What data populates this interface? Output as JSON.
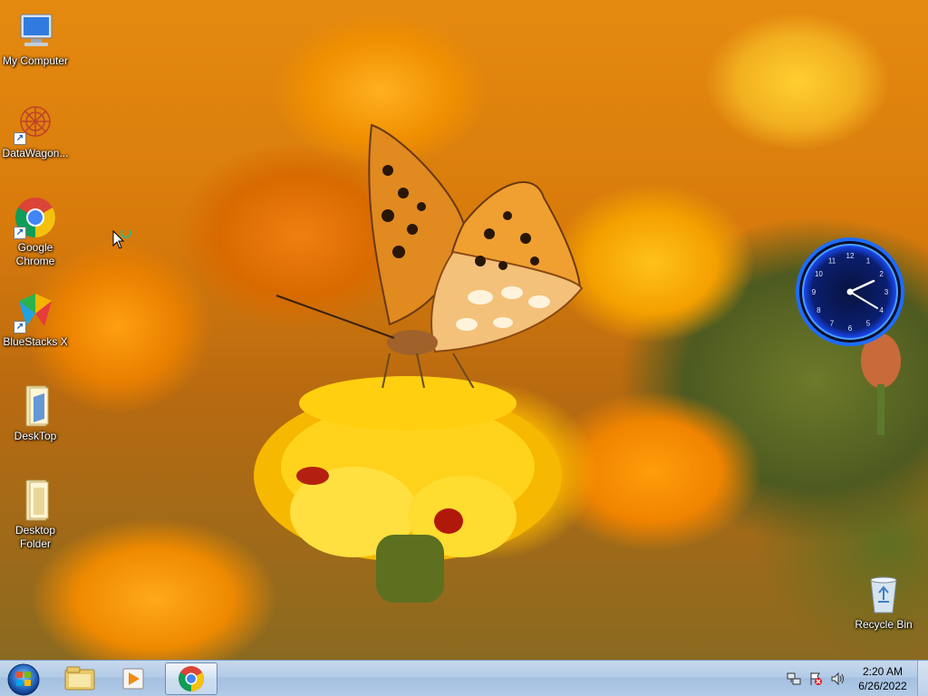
{
  "desktop": {
    "icons": [
      {
        "label": "My Computer",
        "icon": "computer-icon"
      },
      {
        "label": "DataWagon...",
        "icon": "datawagon-icon"
      },
      {
        "label": "Google Chrome",
        "icon": "chrome-icon"
      },
      {
        "label": "BlueStacks X",
        "icon": "bluestacks-icon"
      },
      {
        "label": "DeskTop",
        "icon": "folder-icon"
      },
      {
        "label": "Desktop Folder",
        "icon": "folder-icon"
      },
      {
        "label": "Recycle Bin",
        "icon": "recycle-bin-icon"
      }
    ],
    "clock_gadget": {
      "numerals": [
        "12",
        "1",
        "2",
        "3",
        "4",
        "5",
        "6",
        "7",
        "8",
        "9",
        "10",
        "11"
      ]
    }
  },
  "taskbar": {
    "start_icon": "windows-orb-icon",
    "pinned": [
      {
        "name": "Windows Explorer",
        "icon": "explorer-icon"
      },
      {
        "name": "Media Player",
        "icon": "media-player-icon"
      },
      {
        "name": "Google Chrome",
        "icon": "chrome-icon",
        "active": true
      }
    ],
    "tray": {
      "icons": [
        "network-icon",
        "action-center-flag-icon",
        "speaker-icon"
      ],
      "time": "2:20 AM",
      "date": "6/26/2022"
    }
  },
  "colors": {
    "taskbar": "#b3cbe6",
    "clock_glow": "#1e6cff"
  }
}
